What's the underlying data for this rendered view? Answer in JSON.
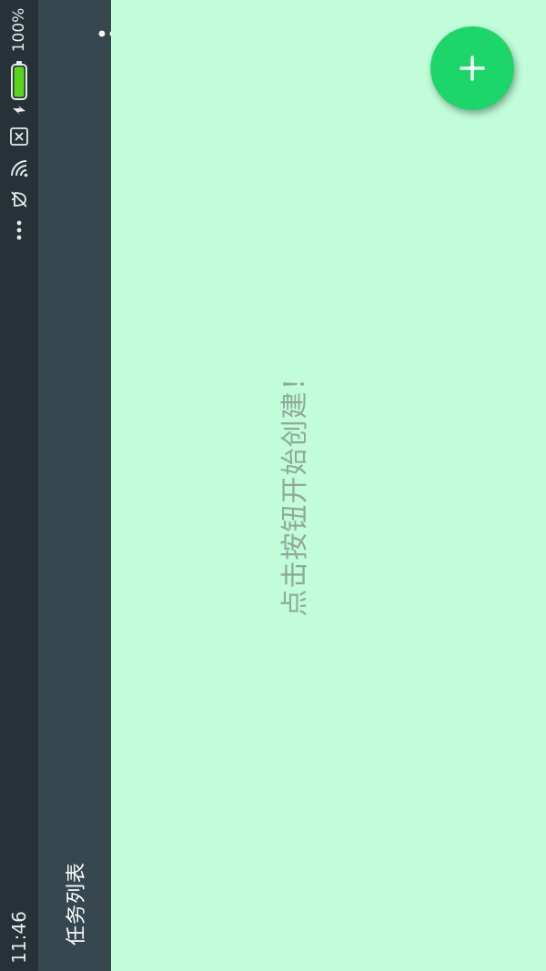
{
  "status_bar": {
    "time": "11:46",
    "battery_percent": "100%",
    "icons": [
      "more-dots-icon",
      "silent-icon",
      "wifi-icon",
      "sim-blocked-icon",
      "charging-icon",
      "battery-icon"
    ]
  },
  "toolbar": {
    "title": "任务列表",
    "menu_icon": "overflow-menu-icon"
  },
  "main": {
    "empty_hint": "点击按钮开始创建！",
    "fab_icon": "plus-icon"
  },
  "colors": {
    "status_bar_bg": "#263238",
    "toolbar_bg": "#37474f",
    "content_bg": "#c1fdd9",
    "fab": "#1dd66a",
    "hint_text": "#8fa99b"
  }
}
